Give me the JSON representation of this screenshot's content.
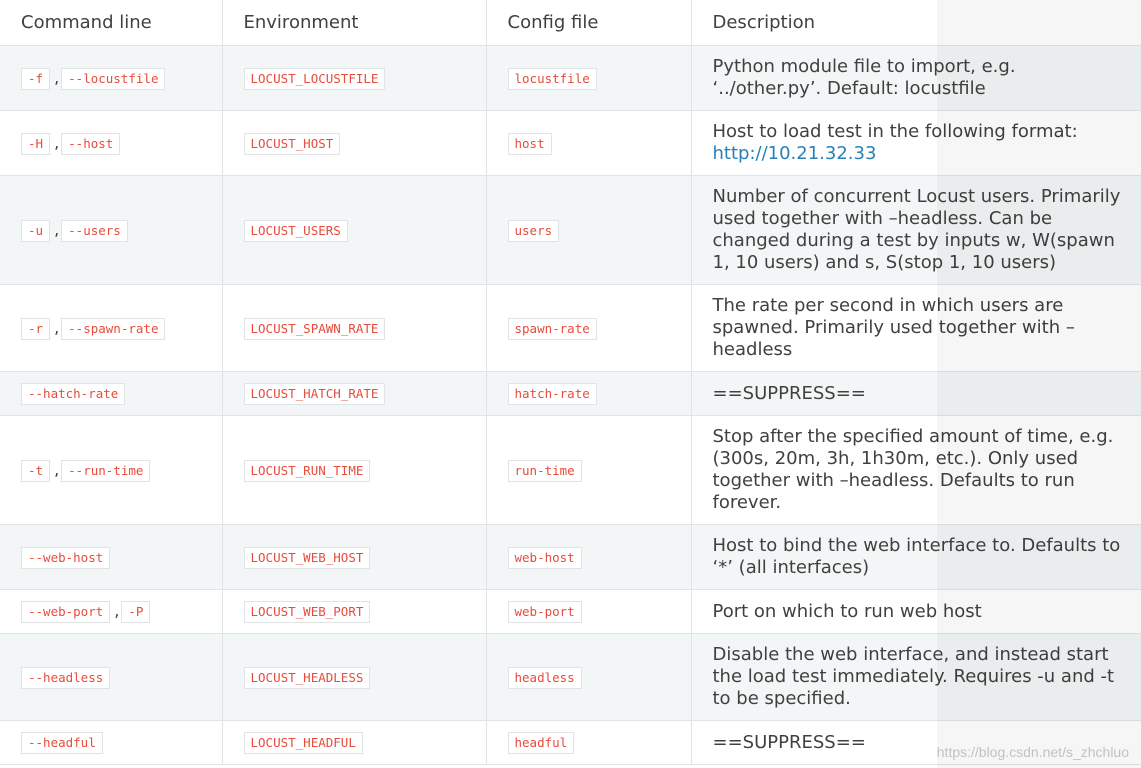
{
  "headers": {
    "command_line": "Command line",
    "environment": "Environment",
    "config_file": "Config file",
    "description": "Description"
  },
  "rows": [
    {
      "cmd": [
        "-f",
        "--locustfile"
      ],
      "env": "LOCUST_LOCUSTFILE",
      "config": "locustfile",
      "desc": "Python module file to import, e.g. ‘../other.py’. Default: locustfile"
    },
    {
      "cmd": [
        "-H",
        "--host"
      ],
      "env": "LOCUST_HOST",
      "config": "host",
      "desc": "Host to load test in the following format:",
      "desc_link": "http://10.21.32.33"
    },
    {
      "cmd": [
        "-u",
        "--users"
      ],
      "env": "LOCUST_USERS",
      "config": "users",
      "desc": "Number of concurrent Locust users. Primarily used together with –headless. Can be changed during a test by inputs w, W(spawn 1, 10 users) and s, S(stop 1, 10 users)"
    },
    {
      "cmd": [
        "-r",
        "--spawn-rate"
      ],
      "env": "LOCUST_SPAWN_RATE",
      "config": "spawn-rate",
      "desc": "The rate per second in which users are spawned. Primarily used together with –headless"
    },
    {
      "cmd": [
        "--hatch-rate"
      ],
      "env": "LOCUST_HATCH_RATE",
      "config": "hatch-rate",
      "desc": "==SUPPRESS=="
    },
    {
      "cmd": [
        "-t",
        "--run-time"
      ],
      "env": "LOCUST_RUN_TIME",
      "config": "run-time",
      "desc": "Stop after the specified amount of time, e.g. (300s, 20m, 3h, 1h30m, etc.). Only used together with –headless. Defaults to run forever."
    },
    {
      "cmd": [
        "--web-host"
      ],
      "env": "LOCUST_WEB_HOST",
      "config": "web-host",
      "desc": "Host to bind the web interface to. Defaults to ‘*’ (all interfaces)"
    },
    {
      "cmd": [
        "--web-port",
        "-P"
      ],
      "env": "LOCUST_WEB_PORT",
      "config": "web-port",
      "desc": "Port on which to run web host"
    },
    {
      "cmd": [
        "--headless"
      ],
      "env": "LOCUST_HEADLESS",
      "config": "headless",
      "desc": "Disable the web interface, and instead start the load test immediately. Requires -u and -t to be specified."
    },
    {
      "cmd": [
        "--headful"
      ],
      "env": "LOCUST_HEADFUL",
      "config": "headful",
      "desc": "==SUPPRESS=="
    }
  ],
  "separator": ",",
  "watermark": "https://blog.csdn.net/s_zhchluo",
  "colors": {
    "literal_text": "#e74c3c",
    "link": "#2980b9",
    "row_stripe": "#f3f6f6",
    "border": "#e1e4e5"
  }
}
